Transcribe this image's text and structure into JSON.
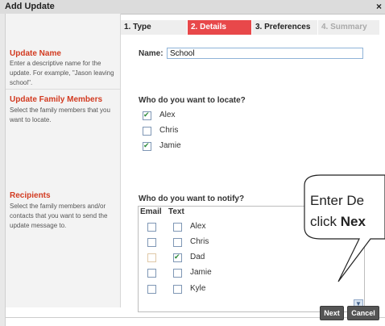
{
  "dialog": {
    "title": "Add Update",
    "close_glyph": "×"
  },
  "steps": [
    {
      "label": "1. Type"
    },
    {
      "label": "2. Details"
    },
    {
      "label": "3. Preferences"
    },
    {
      "label": "4. Summary"
    }
  ],
  "sections": {
    "update_name": {
      "title": "Update Name",
      "description": "Enter a descriptive name for the update. For example, \"Jason leaving school\".",
      "field_label": "Name:",
      "field_value": "School"
    },
    "family_members": {
      "title": "Update Family Members",
      "description": "Select the family members that you want to locate.",
      "question": "Who do you want to locate?",
      "members": [
        {
          "name": "Alex",
          "checked": true
        },
        {
          "name": "Chris",
          "checked": false
        },
        {
          "name": "Jamie",
          "checked": true
        }
      ]
    },
    "recipients": {
      "title": "Recipients",
      "description": "Select the family members and/or contacts that you want to send the update message to.",
      "question": "Who do you want to notify?",
      "columns": {
        "email": "Email",
        "text": "Text"
      },
      "rows": [
        {
          "name": "Alex",
          "email": false,
          "text": false
        },
        {
          "name": "Chris",
          "email": false,
          "text": false
        },
        {
          "name": "Dad",
          "email": false,
          "text": true
        },
        {
          "name": "Jamie",
          "email": false,
          "text": false
        },
        {
          "name": "Kyle",
          "email": false,
          "text": false
        }
      ]
    }
  },
  "buttons": {
    "next": "Next",
    "cancel": "Cancel"
  },
  "callout": {
    "line1": "Enter De",
    "line2_prefix": "click ",
    "line2_bold": "Nex"
  },
  "colors": {
    "accent": "#e8484a",
    "section_title": "#d23a20",
    "button": "#555555"
  },
  "icons": [
    "close-icon",
    "checkbox-icon",
    "scroll-down-icon"
  ]
}
